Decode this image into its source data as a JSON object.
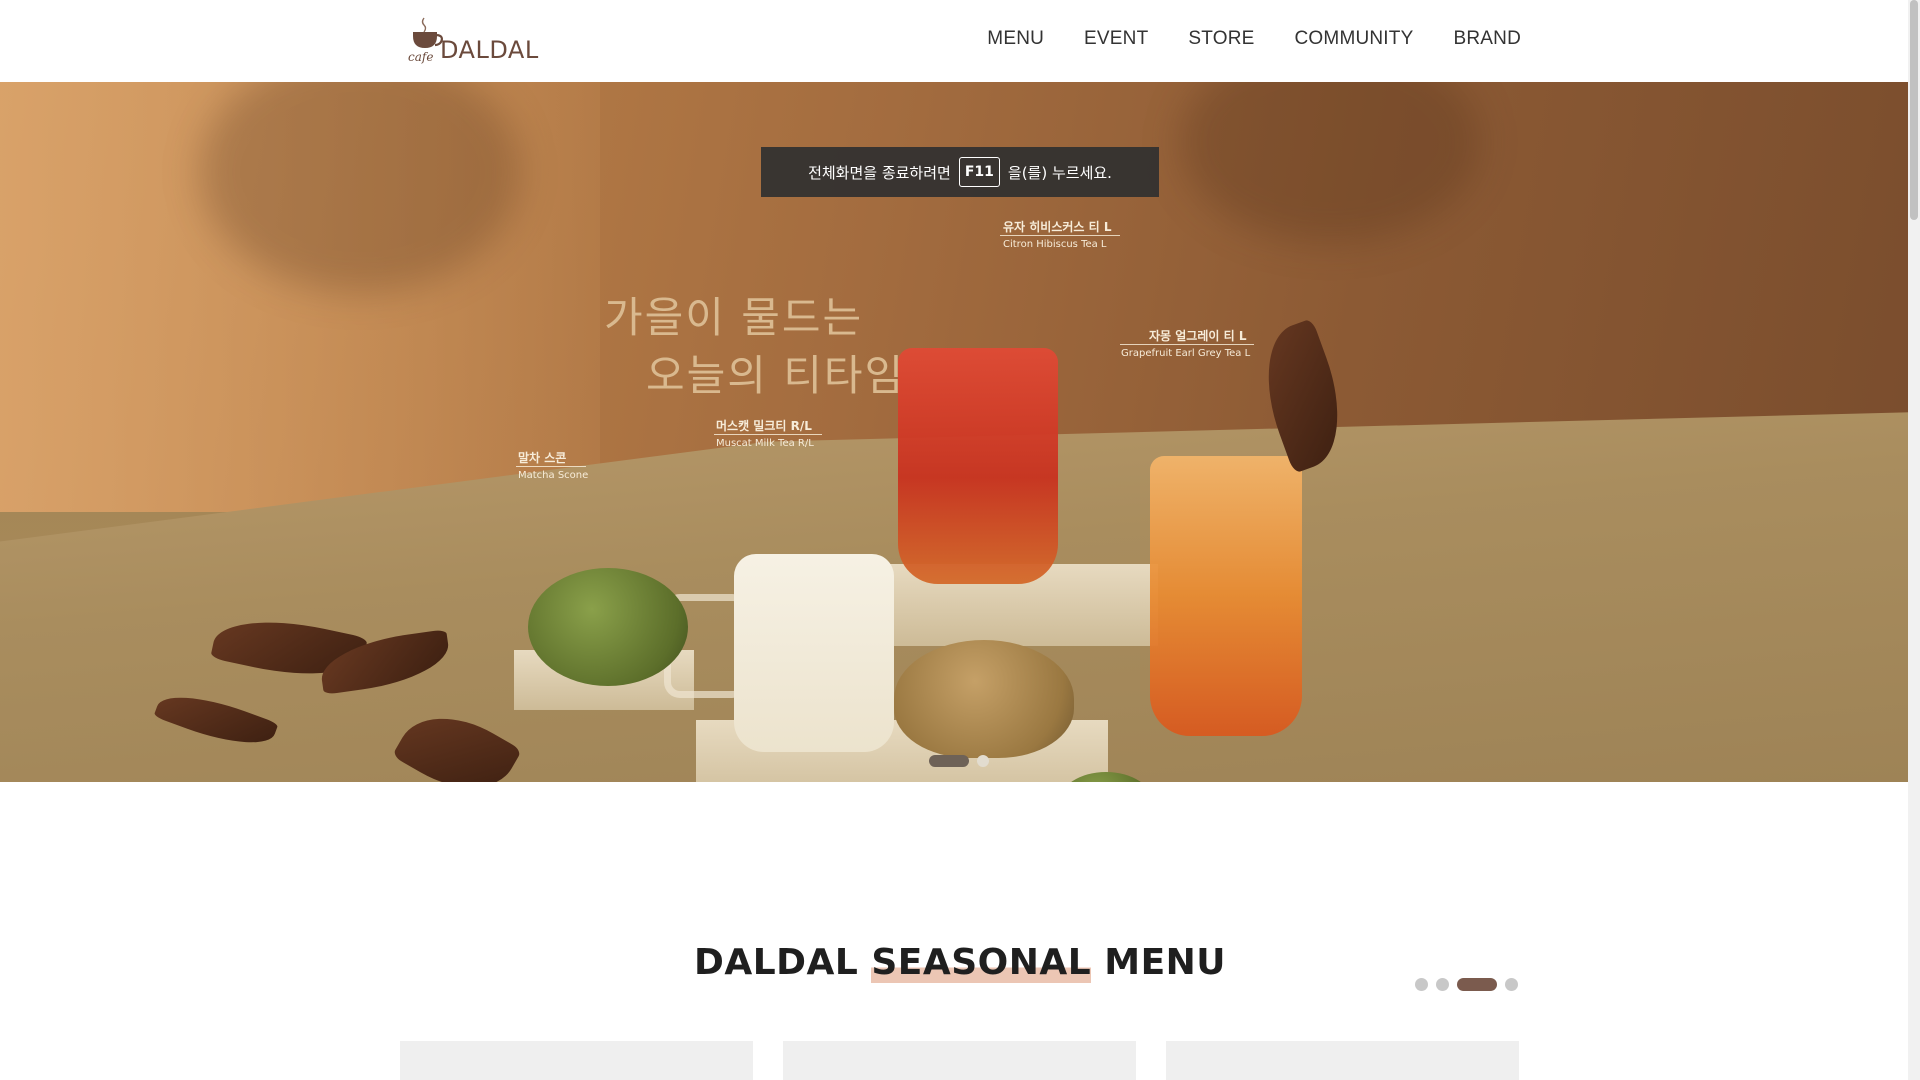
{
  "header": {
    "logo": {
      "cafe": "cafe",
      "name": "DALDAL"
    },
    "nav": [
      "MENU",
      "EVENT",
      "STORE",
      "COMMUNITY",
      "BRAND"
    ]
  },
  "hero": {
    "fullscreen_notice": {
      "before": "전체화면을 종료하려면",
      "key": "F11",
      "after": "을(를) 누르세요."
    },
    "copy_line1": "가을이 물드는",
    "copy_line2": "오늘의 티타임",
    "products": [
      {
        "ko": "유자 히비스커스 티 L",
        "en": "Citron Hibiscus Tea L"
      },
      {
        "ko": "자몽 얼그레이 티 L",
        "en": "Grapefruit Earl Grey Tea L"
      },
      {
        "ko": "머스캣 밀크티 R/L",
        "en": "Muscat Milk Tea R/L"
      },
      {
        "ko": "말차 스콘",
        "en": "Matcha Scone"
      }
    ],
    "slider": {
      "count": 2,
      "active_index": 0
    }
  },
  "seasonal": {
    "title_pre": "DALDAL ",
    "title_highlight": "SEASONAL",
    "title_post": " MENU",
    "slider": {
      "count": 4,
      "active_index": 2
    },
    "card_count": 3
  },
  "colors": {
    "brand": "#6b4a3c",
    "highlight": "#ecc6b4",
    "active_dot": "#7b5b4e"
  }
}
